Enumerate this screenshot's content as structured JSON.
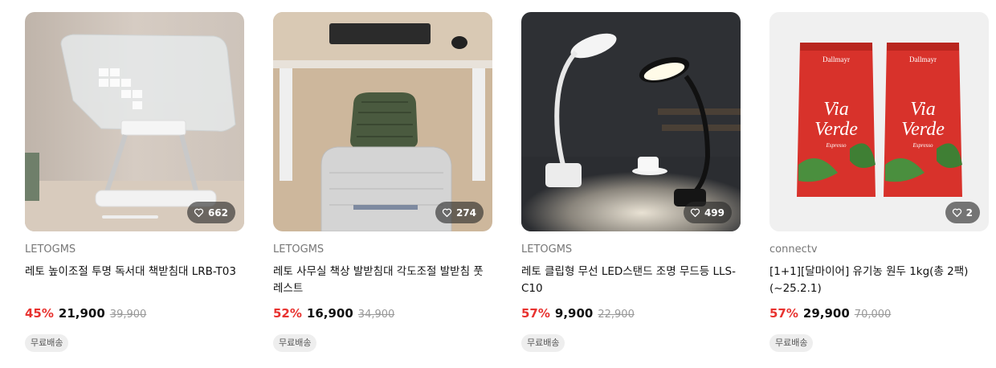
{
  "products": [
    {
      "brand": "LETOGMS",
      "title": "레토 높이조절 투명 독서대 책받침대 LRB-T03",
      "discount": "45%",
      "price": "21,900",
      "original_price": "39,900",
      "likes": "662",
      "shipping_badge": "무료배송"
    },
    {
      "brand": "LETOGMS",
      "title": "레토 사무실 책상 발받침대 각도조절 발받침 풋레스트",
      "discount": "52%",
      "price": "16,900",
      "original_price": "34,900",
      "likes": "274",
      "shipping_badge": "무료배송"
    },
    {
      "brand": "LETOGMS",
      "title": "레토 클립형 무선 LED스탠드 조명 무드등 LLS-C10",
      "discount": "57%",
      "price": "9,900",
      "original_price": "22,900",
      "likes": "499",
      "shipping_badge": "무료배송"
    },
    {
      "brand": "connectv",
      "title": "[1+1][달마이어] 유기농 원두 1kg(총 2팩) (~25.2.1)",
      "discount": "57%",
      "price": "29,900",
      "original_price": "70,000",
      "likes": "2",
      "shipping_badge": "무료배송",
      "package_logo_text": "Dallmayr",
      "package_product_text": "Via Verde",
      "package_variant_text": "Espresso"
    }
  ],
  "colors": {
    "discount": "#e8322f",
    "muted": "#777777",
    "badge_bg": "#eeeeee"
  },
  "icons": {
    "like": "heart-outline-icon"
  }
}
